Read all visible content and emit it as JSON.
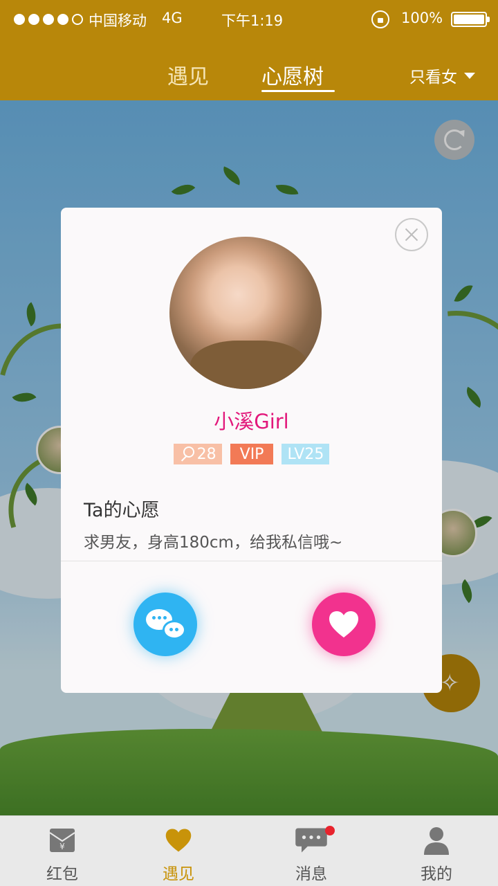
{
  "status_bar": {
    "carrier": "中国移动",
    "network": "4G",
    "time": "下午1:19",
    "battery": "100%"
  },
  "header": {
    "tabs": [
      {
        "label": "遇见",
        "active": false
      },
      {
        "label": "心愿树",
        "active": true
      }
    ],
    "filter_label": "只看女"
  },
  "profile": {
    "nickname": "小溪Girl",
    "age": "28",
    "vip": "VIP",
    "level": "LV25",
    "wish_title": "Ta的心愿",
    "wish_text": "求男友，身高180cm，给我私信哦~"
  },
  "colors": {
    "header_bg": "#B8870A",
    "nickname": "#E2187B",
    "chat_button": "#2FB4F2",
    "like_button": "#F2328E",
    "nav_active": "#C8930A",
    "badge_age": "#F8C0A6",
    "badge_vip": "#F27A56",
    "badge_level": "#AFE3F5"
  },
  "bottom_nav": [
    {
      "label": "红包",
      "icon": "red-envelope-icon",
      "active": false
    },
    {
      "label": "遇见",
      "icon": "heart-icon",
      "active": true
    },
    {
      "label": "消息",
      "icon": "message-icon",
      "active": false,
      "badge": true
    },
    {
      "label": "我的",
      "icon": "person-icon",
      "active": false
    }
  ]
}
